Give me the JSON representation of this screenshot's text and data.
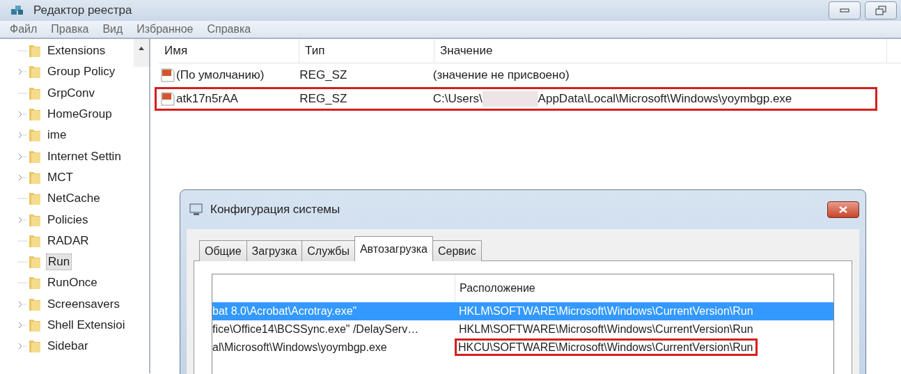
{
  "window": {
    "title": "Редактор реестра"
  },
  "menu": [
    "Файл",
    "Правка",
    "Вид",
    "Избранное",
    "Справка"
  ],
  "tree": [
    {
      "label": "Extensions",
      "expandable": false,
      "selected": false
    },
    {
      "label": "Group Policy",
      "expandable": true,
      "selected": false
    },
    {
      "label": "GrpConv",
      "expandable": false,
      "selected": false
    },
    {
      "label": "HomeGroup",
      "expandable": true,
      "selected": false
    },
    {
      "label": "ime",
      "expandable": true,
      "selected": false
    },
    {
      "label": "Internet Settin",
      "expandable": true,
      "selected": false
    },
    {
      "label": "MCT",
      "expandable": true,
      "selected": false
    },
    {
      "label": "NetCache",
      "expandable": false,
      "selected": false
    },
    {
      "label": "Policies",
      "expandable": true,
      "selected": false
    },
    {
      "label": "RADAR",
      "expandable": false,
      "selected": false
    },
    {
      "label": "Run",
      "expandable": false,
      "selected": true
    },
    {
      "label": "RunOnce",
      "expandable": false,
      "selected": false
    },
    {
      "label": "Screensavers",
      "expandable": true,
      "selected": false
    },
    {
      "label": "Shell Extensioi",
      "expandable": true,
      "selected": false
    },
    {
      "label": "Sidebar",
      "expandable": true,
      "selected": false
    }
  ],
  "values_table": {
    "columns": [
      "Имя",
      "Тип",
      "Значение"
    ],
    "rows": [
      {
        "name": "(По умолчанию)",
        "type": "REG_SZ",
        "value": [
          "(значение не присвоено)"
        ],
        "highlighted": false
      },
      {
        "name": "atk17n5rAA",
        "type": "REG_SZ",
        "value": [
          "C:\\Users\\",
          "AppData\\Local\\Microsoft\\Windows\\yoymbgp.exe"
        ],
        "highlighted": true
      }
    ]
  },
  "dialog": {
    "title": "Конфигурация системы",
    "tabs": [
      {
        "label": "Общие",
        "selected": false
      },
      {
        "label": "Загрузка",
        "selected": false
      },
      {
        "label": "Службы",
        "selected": false
      },
      {
        "label": "Автозагрузка",
        "selected": true
      },
      {
        "label": "Сервис",
        "selected": false
      }
    ],
    "columns": [
      "Расположение"
    ],
    "rows": [
      {
        "command": "bat 8.0\\Acrobat\\Acrotray.exe\"",
        "location": "HKLM\\SOFTWARE\\Microsoft\\Windows\\CurrentVersion\\Run",
        "selected": true,
        "highlighted": false
      },
      {
        "command": "fice\\Office14\\BCSSync.exe\" /DelayServ…",
        "location": "HKLM\\SOFTWARE\\Microsoft\\Windows\\CurrentVersion\\Run",
        "selected": false,
        "highlighted": false
      },
      {
        "command": "al\\Microsoft\\Windows\\yoymbgp.exe",
        "location": "HKCU\\SOFTWARE\\Microsoft\\Windows\\CurrentVersion\\Run",
        "selected": false,
        "highlighted": true
      }
    ]
  }
}
